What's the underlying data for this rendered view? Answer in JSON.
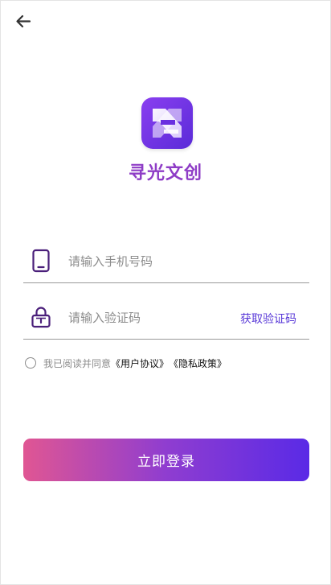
{
  "header": {
    "back_icon": "arrow-left-icon"
  },
  "brand": {
    "logo_icon": "app-logo-icon",
    "name": "寻光文创",
    "name_color": "#8e3cc6"
  },
  "form": {
    "phone": {
      "icon": "phone-icon",
      "placeholder": "请输入手机号码",
      "value": ""
    },
    "code": {
      "icon": "lock-icon",
      "placeholder": "请输入验证码",
      "value": "",
      "get_code_label": "获取验证码"
    }
  },
  "agreement": {
    "checked": false,
    "prefix": "我已阅读并同意",
    "user_agreement": "《用户协议》",
    "privacy_policy": "《隐私政策》"
  },
  "login_button": {
    "label": "立即登录",
    "gradient": [
      "#e05693",
      "#8f3dd0",
      "#5a2ae6"
    ]
  },
  "colors": {
    "accent": "#5a3ad8",
    "icon": "#4a1f7a",
    "divider": "#9a9a9a"
  }
}
